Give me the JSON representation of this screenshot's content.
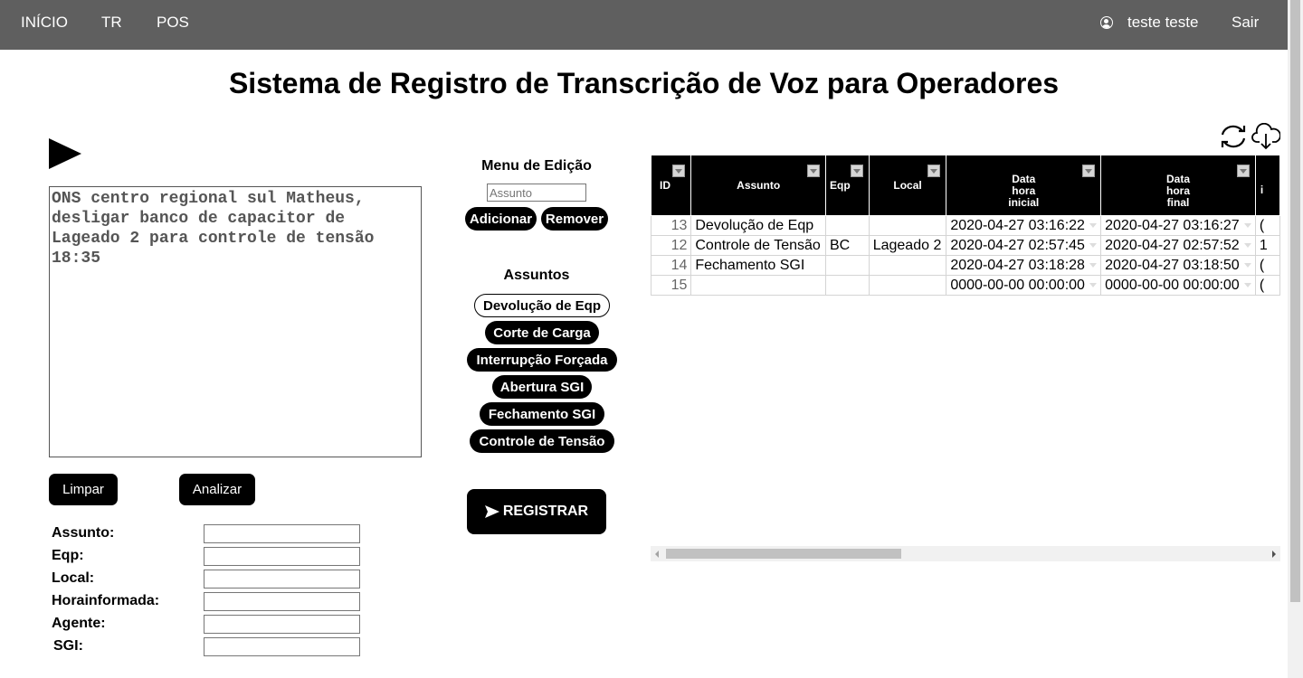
{
  "nav": {
    "links": [
      "INÍCIO",
      "TR",
      "POS"
    ],
    "user": "teste teste",
    "logout": "Sair"
  },
  "page": {
    "title": "Sistema de Registro de Transcrição de Voz para Operadores"
  },
  "transcript": {
    "text": "ONS centro regional sul Matheus, desligar banco de capacitor de Lageado 2 para controle de tensão 18:35",
    "clear_label": "Limpar",
    "analyze_label": "Analizar"
  },
  "form": {
    "fields": [
      {
        "label": "Assunto:",
        "value": ""
      },
      {
        "label": "Eqp:",
        "value": ""
      },
      {
        "label": "Local:",
        "value": ""
      },
      {
        "label": "Horainformada:",
        "value": ""
      },
      {
        "label": "Agente:",
        "value": ""
      },
      {
        "label": "SGI:",
        "value": ""
      }
    ]
  },
  "edit_menu": {
    "title": "Menu de Edição",
    "input_placeholder": "Assunto",
    "add_label": "Adicionar",
    "remove_label": "Remover"
  },
  "assuntos": {
    "title": "Assuntos",
    "selected": "Devolução de Eqp",
    "items": [
      "Devolução de Eqp",
      "Corte de Carga",
      "Interrupção Forçada",
      "Abertura SGI",
      "Fechamento SGI",
      "Controle de Tensão"
    ]
  },
  "register": {
    "label": "REGISTRAR",
    "icon": "send-icon"
  },
  "toolbar_icons": [
    "refresh-icon",
    "cloud-download-icon"
  ],
  "grid": {
    "columns": [
      {
        "lines": [
          "ID"
        ]
      },
      {
        "lines": [
          "Assunto"
        ]
      },
      {
        "lines": [
          "Eqp"
        ]
      },
      {
        "lines": [
          "Local"
        ]
      },
      {
        "lines": [
          "Data",
          "hora",
          "inicial"
        ]
      },
      {
        "lines": [
          "Data",
          "hora",
          "final"
        ]
      },
      {
        "lines": [
          "i"
        ]
      }
    ],
    "rows": [
      {
        "id": "13",
        "assunto": "Devolução de Eqp",
        "eqp": "",
        "local": "",
        "inicio": "2020-04-27 03:16:22",
        "fim": "2020-04-27 03:16:27",
        "extra": "("
      },
      {
        "id": "12",
        "assunto": "Controle de Tensão",
        "eqp": "BC",
        "local": "Lageado 2",
        "inicio": "2020-04-27 02:57:45",
        "fim": "2020-04-27 02:57:52",
        "extra": "1"
      },
      {
        "id": "14",
        "assunto": "Fechamento SGI",
        "eqp": "",
        "local": "",
        "inicio": "2020-04-27 03:18:28",
        "fim": "2020-04-27 03:18:50",
        "extra": "("
      },
      {
        "id": "15",
        "assunto": "",
        "eqp": "",
        "local": "",
        "inicio": "0000-00-00 00:00:00",
        "fim": "0000-00-00 00:00:00",
        "extra": "("
      }
    ]
  }
}
